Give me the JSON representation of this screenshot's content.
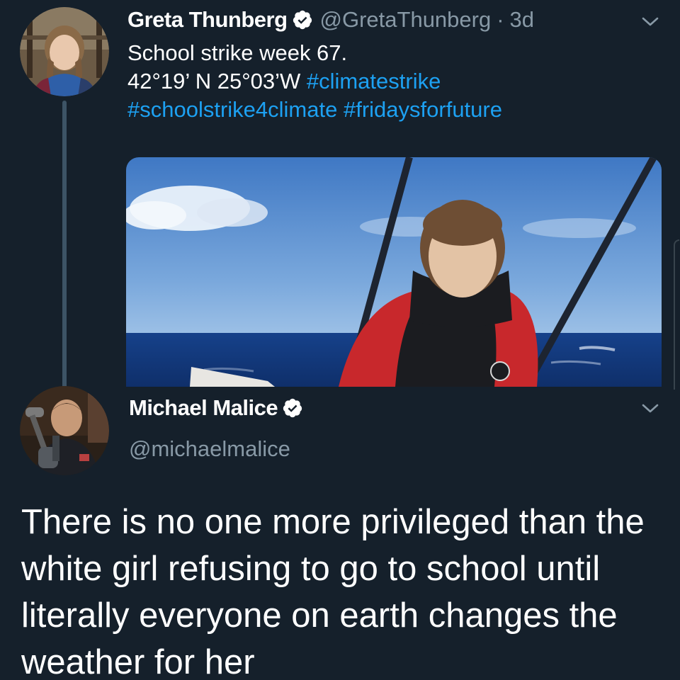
{
  "tweet1": {
    "name": "Greta Thunberg",
    "handle": "@GretaThunberg",
    "separator": "·",
    "time": "3d",
    "text_line1": "School strike week 67.",
    "text_line2_prefix": "42°19’ N 25°03’W ",
    "hashtag1": "#climatestrike",
    "hashtag2": "#schoolstrike4climate",
    "hashtag3": "#fridaysforfuture",
    "verified_icon": "verified-badge-icon",
    "menu_icon": "chevron-down-icon"
  },
  "tweet2": {
    "name": "Michael Malice",
    "handle": "@michaelmalice",
    "text": "There is no one more privileged than the white girl refusing to go to school until literally everyone on earth changes the weather for her",
    "verified_icon": "verified-badge-icon",
    "menu_icon": "chevron-down-icon"
  },
  "colors": {
    "background": "#15202b",
    "link": "#1da1f2",
    "secondary_text": "#8899a6",
    "thread_line": "#3d5466"
  }
}
